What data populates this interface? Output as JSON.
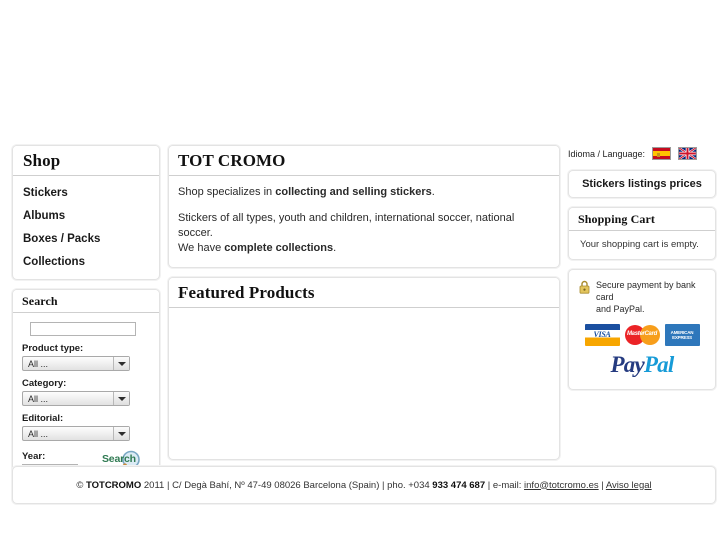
{
  "left": {
    "shop": {
      "title": "Shop",
      "items": [
        {
          "label": "Stickers"
        },
        {
          "label": "Albums"
        },
        {
          "label": "Boxes / Packs"
        },
        {
          "label": "Collections"
        }
      ]
    },
    "search": {
      "title": "Search",
      "keyword_value": "",
      "fields": [
        {
          "label": "Product type:",
          "value": "All ..."
        },
        {
          "label": "Category:",
          "value": "All ..."
        },
        {
          "label": "Editorial:",
          "value": "All ..."
        }
      ],
      "year_label": "Year:",
      "year_value": "",
      "button_label": "Search"
    }
  },
  "center": {
    "intro": {
      "title": "TOT CROMO",
      "line1_prefix": "Shop specializes in ",
      "line1_strong": "collecting and selling stickers",
      "line1_suffix": ".",
      "line2": "Stickers of all types, youth and children, international soccer, national soccer.",
      "line3_prefix": "We have ",
      "line3_strong": "complete collections",
      "line3_suffix": "."
    },
    "featured": {
      "title": "Featured Products"
    }
  },
  "right": {
    "language": {
      "label": "Idioma / Language:",
      "flags": [
        {
          "name": "spanish-flag"
        },
        {
          "name": "english-flag"
        }
      ]
    },
    "prices_button": "Stickers listings prices",
    "cart": {
      "title": "Shopping Cart",
      "empty_text": "Your shopping cart is empty."
    },
    "payment": {
      "line1": "Secure payment by bank card",
      "line2": "and PayPal.",
      "cards": [
        {
          "name": "visa",
          "text": "VISA"
        },
        {
          "name": "mastercard",
          "text": "MasterCard"
        },
        {
          "name": "american-express",
          "line1": "AMERICAN",
          "line2": "EXPRESS"
        }
      ],
      "paypal_part1": "Pay",
      "paypal_part2": "Pal"
    }
  },
  "footer": {
    "copyright_symbol": "© ",
    "brand": "TOTCROMO",
    "mid": " 2011 | C/ Degà Bahí, Nº 47-49 08026 Barcelona (Spain) | pho. +034 ",
    "phone": "933 474 687",
    "email_prefix": " | e-mail: ",
    "email": "info@totcromo.es",
    "sep": " | ",
    "legal": "Aviso legal"
  },
  "colors": {
    "panel_border": "#e3e3e3",
    "head_rule": "#cfcfcf",
    "search_green": "#2f7a52",
    "paypal_dark": "#253b80",
    "paypal_light": "#179bd7",
    "flag_es_red": "#c60b1e",
    "flag_es_yellow": "#ffc400",
    "flag_uk_blue": "#00247d"
  }
}
